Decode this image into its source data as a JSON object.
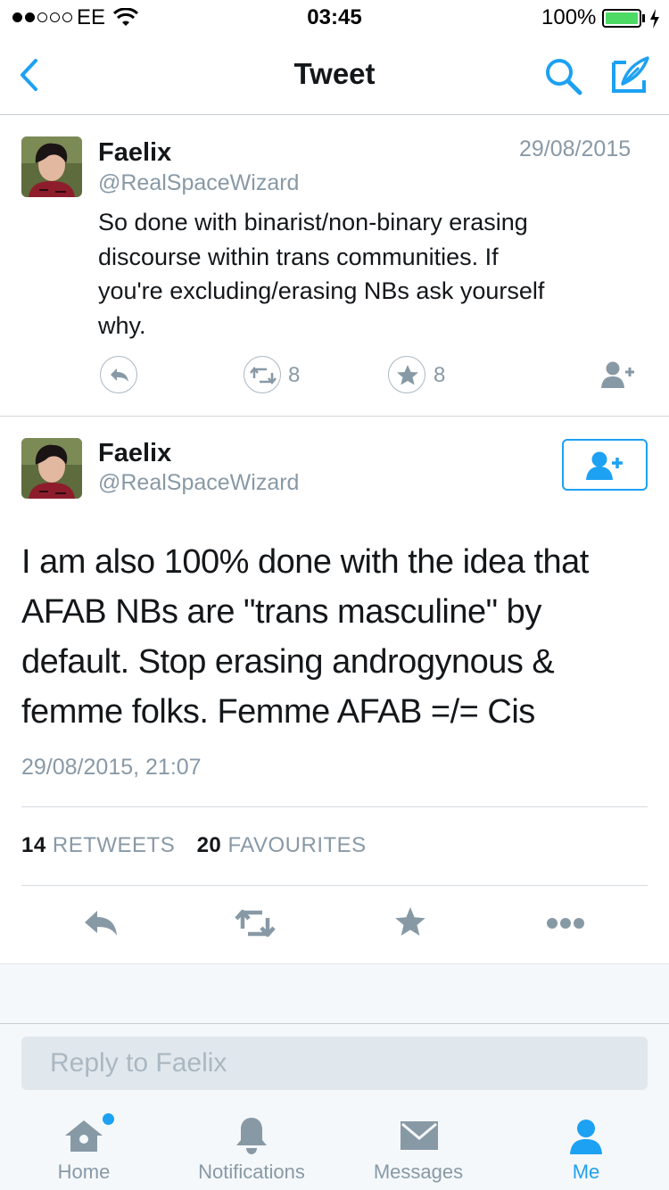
{
  "status_bar": {
    "carrier": "EE",
    "time": "03:45",
    "battery": "100%"
  },
  "nav": {
    "title": "Tweet",
    "back_icon": "chevron-left-icon",
    "search_icon": "search-icon",
    "compose_icon": "compose-icon"
  },
  "parent_tweet": {
    "name": "Faelix",
    "handle": "@RealSpaceWizard",
    "date": "29/08/2015",
    "text_lines": [
      "So done with binarist/non-binary erasing",
      "discourse within trans communities. If",
      "you're excluding/erasing NBs ask yourself",
      "why."
    ],
    "retweet_count": "8",
    "favourite_count": "8"
  },
  "main_tweet": {
    "name": "Faelix",
    "handle": "@RealSpaceWizard",
    "text_lines": [
      "I am also 100% done with the idea that",
      "AFAB NBs are \"trans masculine\" by",
      "default. Stop erasing androgynous &",
      "femme folks. Femme AFAB =/= Cis"
    ],
    "timestamp": "29/08/2015, 21:07",
    "retweets_count": "14",
    "retweets_label": "RETWEETS",
    "favourites_count": "20",
    "favourites_label": "FAVOURITES"
  },
  "reply": {
    "placeholder": "Reply to Faelix"
  },
  "tab_bar": {
    "items": [
      {
        "label": "Home",
        "icon": "home-icon"
      },
      {
        "label": "Notifications",
        "icon": "bell-icon"
      },
      {
        "label": "Messages",
        "icon": "envelope-icon"
      },
      {
        "label": "Me",
        "icon": "person-icon"
      }
    ]
  },
  "colors": {
    "accent": "#1da1f2",
    "muted": "#8899a6",
    "battery": "#4cd964"
  }
}
